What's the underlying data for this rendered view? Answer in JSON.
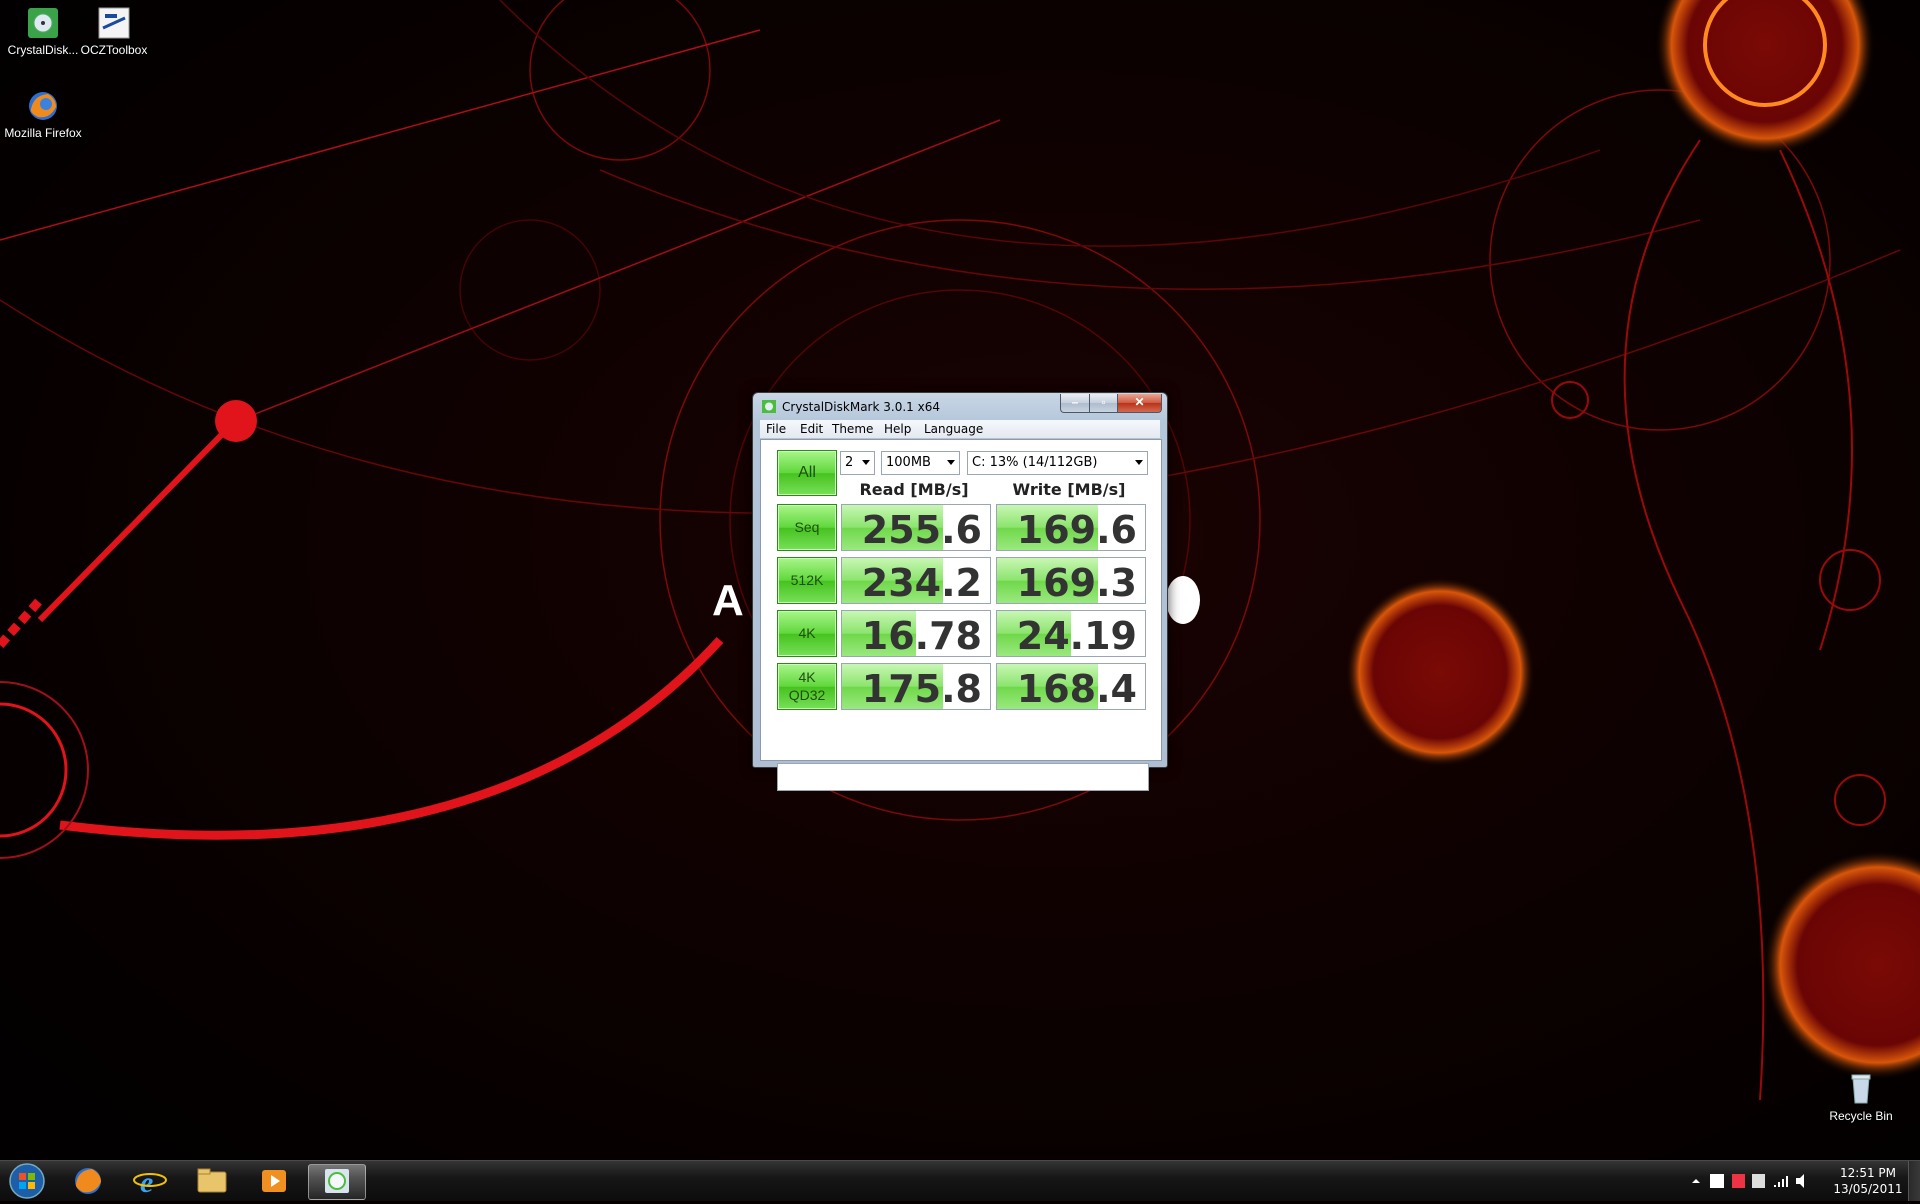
{
  "desktop": {
    "icons": [
      {
        "id": "crystaldisk",
        "label": "CrystalDisk..."
      },
      {
        "id": "ocztoolbox",
        "label": "OCZToolbox"
      },
      {
        "id": "firefox",
        "label": "Mozilla Firefox"
      },
      {
        "id": "recycle",
        "label": "Recycle Bin"
      }
    ]
  },
  "window": {
    "title": "CrystalDiskMark 3.0.1 x64",
    "menu": [
      "File",
      "Edit",
      "Theme",
      "Help",
      "Language"
    ],
    "controls": {
      "all_label": "All",
      "count": "2",
      "size": "100MB",
      "drive": "C: 13% (14/112GB)"
    },
    "headers": {
      "read": "Read [MB/s]",
      "write": "Write [MB/s]"
    },
    "rows": [
      {
        "label": "Seq",
        "label2": "",
        "read": "255.6",
        "write": "169.6",
        "read_fill": 0.68,
        "write_fill": 0.68
      },
      {
        "label": "512K",
        "label2": "",
        "read": "234.2",
        "write": "169.3",
        "read_fill": 0.68,
        "write_fill": 0.68
      },
      {
        "label": "4K",
        "label2": "",
        "read": "16.78",
        "write": "24.19",
        "read_fill": 0.5,
        "write_fill": 0.5
      },
      {
        "label": "4K",
        "label2": "QD32",
        "read": "175.8",
        "write": "168.4",
        "read_fill": 0.68,
        "write_fill": 0.68
      }
    ],
    "status": ""
  },
  "taskbar": {
    "clock_time": "12:51 PM",
    "clock_date": "13/05/2011"
  },
  "colors": {
    "accent_green": "#5fd83b",
    "wallpaper_red": "#e0141a",
    "wallpaper_orange": "#ff7a10"
  }
}
